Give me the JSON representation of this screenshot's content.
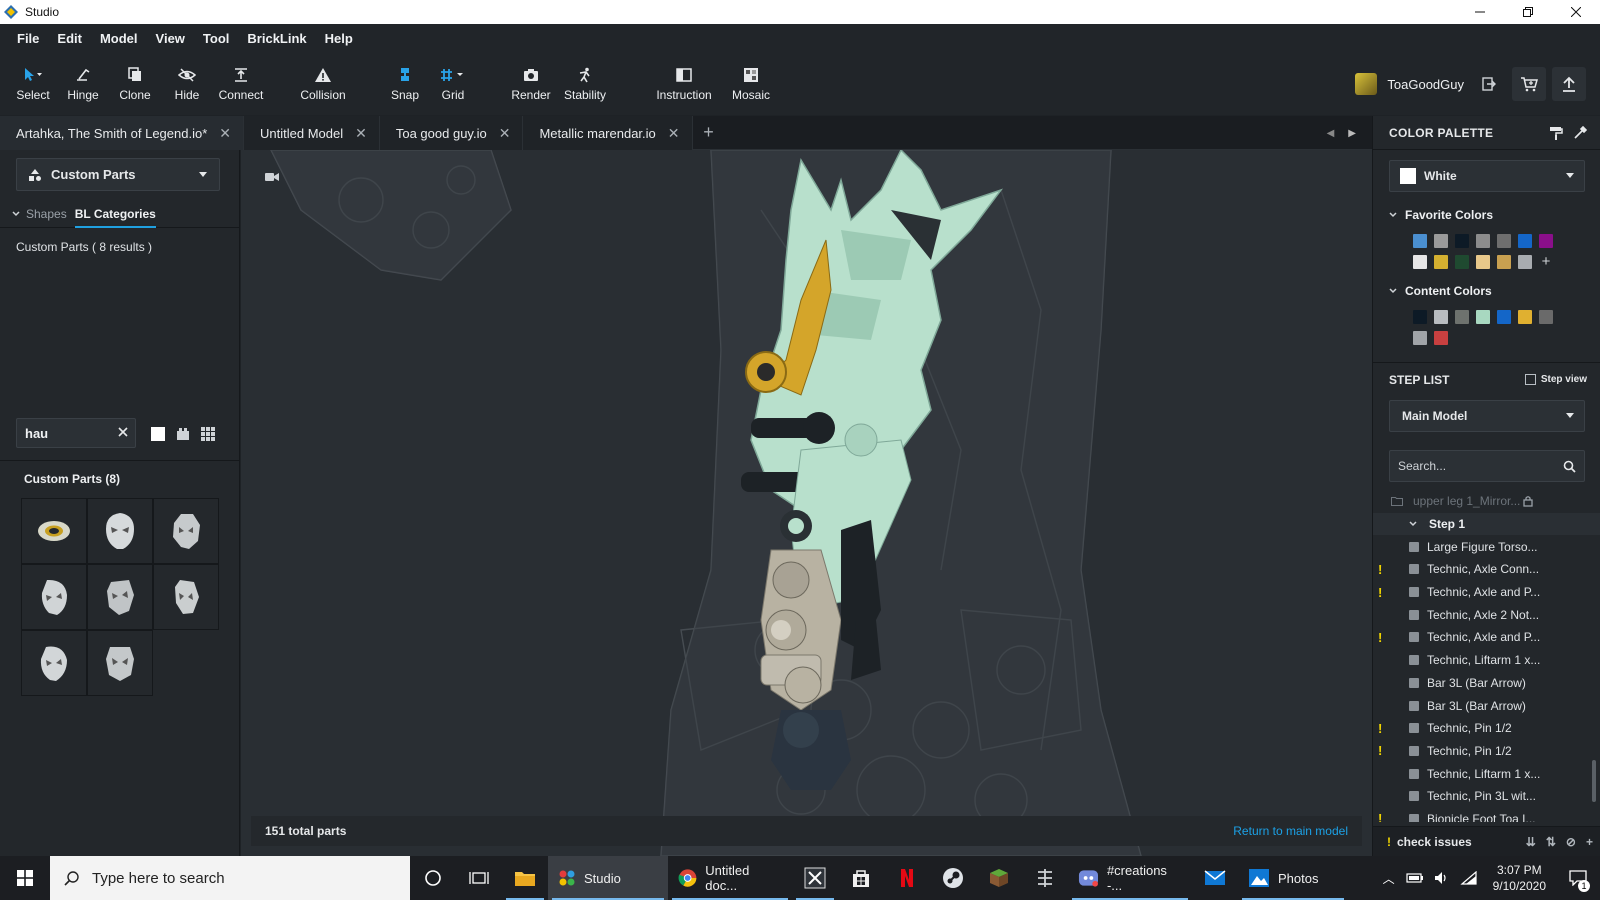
{
  "window": {
    "title": "Studio"
  },
  "menu": [
    "File",
    "Edit",
    "Model",
    "View",
    "Tool",
    "BrickLink",
    "Help"
  ],
  "toolbar": {
    "select": "Select",
    "hinge": "Hinge",
    "clone": "Clone",
    "hide": "Hide",
    "connect": "Connect",
    "collision": "Collision",
    "snap": "Snap",
    "grid": "Grid",
    "render": "Render",
    "stability": "Stability",
    "instruction": "Instruction",
    "mosaic": "Mosaic"
  },
  "user": {
    "name": "ToaGoodGuy"
  },
  "tabs": [
    {
      "label": "Artahka, The Smith of Legend.io*"
    },
    {
      "label": "Untitled Model"
    },
    {
      "label": "Toa good guy.io"
    },
    {
      "label": "Metallic marendar.io"
    }
  ],
  "left_panel": {
    "dropdown": "Custom Parts",
    "tab_shapes": "Shapes",
    "tab_bl": "BL Categories",
    "results": "Custom Parts ( 8 results )",
    "search_value": "hau",
    "parts_title": "Custom Parts (8)"
  },
  "viewport": {
    "total_parts": "151 total parts",
    "return_link": "Return to main model"
  },
  "color_palette": {
    "title": "COLOR PALETTE",
    "selected": "White",
    "favorite_title": "Favorite Colors",
    "favorite_colors": [
      "#4a8fd0",
      "#9a9a9a",
      "#0d1a26",
      "#8c8c8c",
      "#6e6e6e",
      "#1466c8",
      "#8a0f8a",
      "#e6e6e6",
      "#d4b030",
      "#1f4a30",
      "#e8c88a",
      "#c8a050",
      "#a8acb0"
    ],
    "content_title": "Content Colors",
    "content_colors": [
      "#0d1a26",
      "#b8bcc0",
      "#6e726e",
      "#a8d8c0",
      "#1466c8",
      "#e0b030",
      "#6a6a6a",
      "#a0a4a8",
      "#c84040"
    ]
  },
  "step_list": {
    "title": "STEP LIST",
    "step_view": "Step view",
    "model": "Main Model",
    "search_placeholder": "Search...",
    "folder": "upper leg 1_Mirror...",
    "step": "Step 1",
    "items": [
      {
        "label": "Large Figure Torso...",
        "warn": ""
      },
      {
        "label": "Technic, Axle Conn...",
        "warn": "!"
      },
      {
        "label": "Technic, Axle and P...",
        "warn": "!"
      },
      {
        "label": "Technic, Axle 2 Not...",
        "warn": ""
      },
      {
        "label": "Technic, Axle and P...",
        "warn": "!"
      },
      {
        "label": "Technic, Liftarm 1 x...",
        "warn": ""
      },
      {
        "label": "Bar   3L (Bar Arrow)",
        "warn": ""
      },
      {
        "label": "Bar   3L (Bar Arrow)",
        "warn": ""
      },
      {
        "label": "Technic, Pin 1/2",
        "warn": "!"
      },
      {
        "label": "Technic, Pin 1/2",
        "warn": "!"
      },
      {
        "label": "Technic, Liftarm 1 x...",
        "warn": ""
      },
      {
        "label": "Technic, Pin 3L wit...",
        "warn": ""
      },
      {
        "label": "Bionicle Foot Toa I...",
        "warn": "!"
      }
    ],
    "check_issues": "check issues"
  },
  "taskbar": {
    "search_placeholder": "Type here to search",
    "studio": "Studio",
    "chrome": "Untitled doc...",
    "discord": "#creations -...",
    "photos": "Photos",
    "time": "3:07 PM",
    "date": "9/10/2020",
    "notif_count": "1"
  }
}
